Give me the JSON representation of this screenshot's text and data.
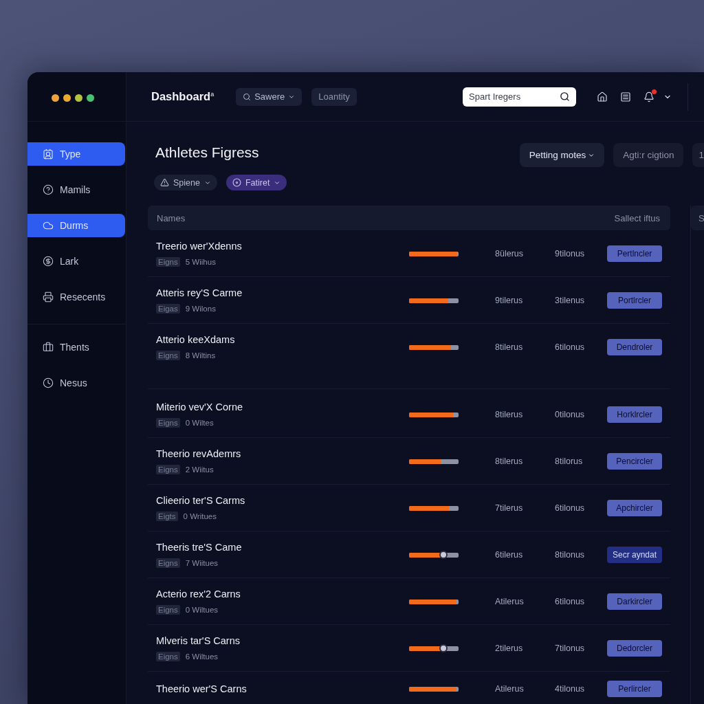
{
  "window": {
    "dots": [
      {
        "color": "#f0a23a"
      },
      {
        "color": "#e9a935"
      },
      {
        "color": "#b4c23c"
      },
      {
        "color": "#4cc072"
      }
    ]
  },
  "topbar": {
    "title": "Dashboard$^{a}$",
    "buttons": [
      {
        "label": "Sawere",
        "kind": "dropdown"
      },
      {
        "label": "Loantity",
        "kind": "plain"
      }
    ],
    "search": {
      "placeholder": "Spart Iregers"
    },
    "alert_badge": true
  },
  "sidebar": {
    "sections": [
      {
        "items": [
          {
            "label": "Type",
            "selected": true
          },
          {
            "label": "Mamils",
            "selected": false
          },
          {
            "label": "Durms",
            "selected": true
          },
          {
            "label": "Lark",
            "selected": false
          },
          {
            "label": "Resecents",
            "selected": false
          }
        ]
      },
      {
        "items": [
          {
            "label": "Thents",
            "selected": false
          },
          {
            "label": "Nesus",
            "selected": false
          }
        ]
      }
    ]
  },
  "main": {
    "title": "Athletes Figress",
    "filters": [
      {
        "label": "Spiene",
        "selected": false
      },
      {
        "label": "Fatiret",
        "selected": true
      }
    ],
    "actions": [
      {
        "label": "Petting motes",
        "kind": "dropdown"
      },
      {
        "label": "Agti:r cigtion",
        "kind": "plain"
      },
      {
        "label": "1",
        "kind": "plain"
      }
    ]
  },
  "table": {
    "columns": [
      "Names",
      "Sallect iftus"
    ],
    "rows": [
      {
        "name": "Treerio wer'Xdenns",
        "tag": "Eigns",
        "detail": "5 Wiihus",
        "progress": {
          "kind": "bar",
          "level": 0.97
        },
        "column_3": "8ülerus",
        "column_4": "9tilonus",
        "action": {
          "label": "Pertlncler",
          "selected": false
        }
      },
      {
        "name": "Atteris rey'S Carme",
        "tag": "Eigas",
        "detail": "9 Wilons",
        "progress": {
          "kind": "bar",
          "level": 0.79
        },
        "column_3": "9tilerus",
        "column_4": "3tilenus",
        "action": {
          "label": "Portlrcler",
          "selected": false
        }
      },
      {
        "name": "Atterio keeXdams",
        "tag": "Eigns",
        "detail": "8 Wiltins",
        "progress": {
          "kind": "bar",
          "level": 0.85
        },
        "column_3": "8tilerus",
        "column_4": "6tilonus",
        "action": {
          "label": "Dendroler",
          "selected": false
        }
      },
      {
        "name": "Miterio vev'X Corne",
        "tag": "Eigns",
        "detail": "0 Wiltes",
        "progress": {
          "kind": "bar",
          "level": 0.89
        },
        "column_3": "8tilerus",
        "column_4": "0tilonus",
        "action": {
          "label": "Horklrcler",
          "selected": false
        }
      },
      {
        "name": "Theerio revAdemrs",
        "tag": "Eigns",
        "detail": "2 Wiitus",
        "progress": {
          "kind": "bar",
          "level": 0.64
        },
        "column_3": "8tilerus",
        "column_4": "8tilorus",
        "action": {
          "label": "Pencircler",
          "selected": false
        }
      },
      {
        "name": "Clieerio ter'S Carms",
        "tag": "Eigts",
        "detail": "0 Writues",
        "progress": {
          "kind": "bar",
          "level": 0.8
        },
        "column_3": "7tilerus",
        "column_4": "6tilonus",
        "action": {
          "label": "Apchircler",
          "selected": false
        }
      },
      {
        "name": "Theeris tre'S Came",
        "tag": "Eigns",
        "detail": "7 Wiitues",
        "progress": {
          "kind": "slider",
          "level": 0.69
        },
        "column_3": "6tilerus",
        "column_4": "8tilonus",
        "action": {
          "label": "Secr ayndat",
          "selected": true
        }
      },
      {
        "name": "Acterio rex'2 Carns",
        "tag": "Eigns",
        "detail": "0 Wiltues",
        "progress": {
          "kind": "bar",
          "level": 0.96
        },
        "column_3": "Atilerus",
        "column_4": "6tilonus",
        "action": {
          "label": "Darkircler",
          "selected": false
        }
      },
      {
        "name": "Mlveris tar'S Carns",
        "tag": "Eigns",
        "detail": "6 Wiltues",
        "progress": {
          "kind": "slider",
          "level": 0.69
        },
        "column_3": "2tilerus",
        "column_4": "7tilonus",
        "action": {
          "label": "Dedorcler",
          "selected": false
        }
      },
      {
        "name": "Theerio wer'S Carns",
        "progress": {
          "kind": "bar",
          "level": 0.96
        },
        "column_3": "Atilerus",
        "column_4": "4tilonus",
        "action": {
          "label": "Perlircler",
          "selected": false
        }
      }
    ]
  },
  "side_panel": {
    "header": "S"
  }
}
